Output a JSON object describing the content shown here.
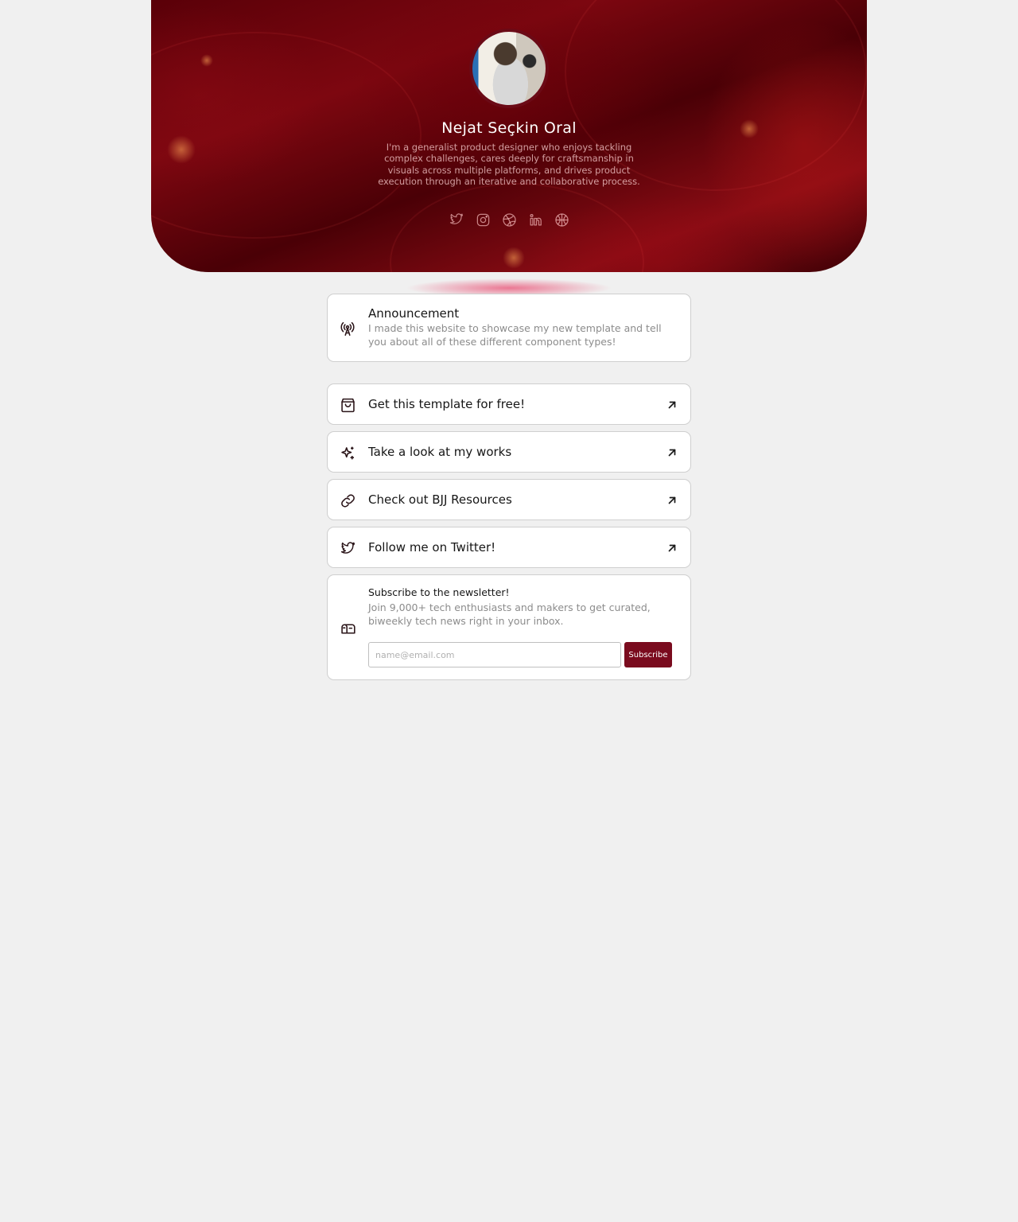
{
  "profile": {
    "name": "Nejat Seçkin Oral",
    "bio": "I'm a generalist product designer who enjoys tackling complex challenges, cares deeply for craftsmanship in visuals across multiple platforms, and drives product execution through an iterative and collaborative process."
  },
  "socials": [
    {
      "icon": "twitter-icon"
    },
    {
      "icon": "instagram-icon"
    },
    {
      "icon": "dribbble-icon"
    },
    {
      "icon": "linkedin-icon"
    },
    {
      "icon": "basketball-icon"
    }
  ],
  "announcement": {
    "title": "Announcement",
    "text": "I made this website to showcase my new template and tell you about all of these different component types!",
    "icon": "broadcast-icon"
  },
  "links": [
    {
      "label": "Get this template for free!",
      "icon": "shopping-bag-icon"
    },
    {
      "label": "Take a look at my works",
      "icon": "sparkles-icon"
    },
    {
      "label": "Check out BJJ Resources",
      "icon": "link-icon"
    },
    {
      "label": "Follow me on Twitter!",
      "icon": "twitter-icon"
    }
  ],
  "newsletter": {
    "title": "Subscribe to the newsletter!",
    "text": "Join 9,000+ tech enthusiasts and makers to get curated, biweekly tech news right in your inbox.",
    "placeholder": "name@email.com",
    "value": "",
    "button_label": "Subscribe",
    "icon": "mailbox-icon"
  },
  "colors": {
    "accent": "#7a0b1e",
    "hero": "#6a0610",
    "page_background": "#f0f0f0"
  }
}
